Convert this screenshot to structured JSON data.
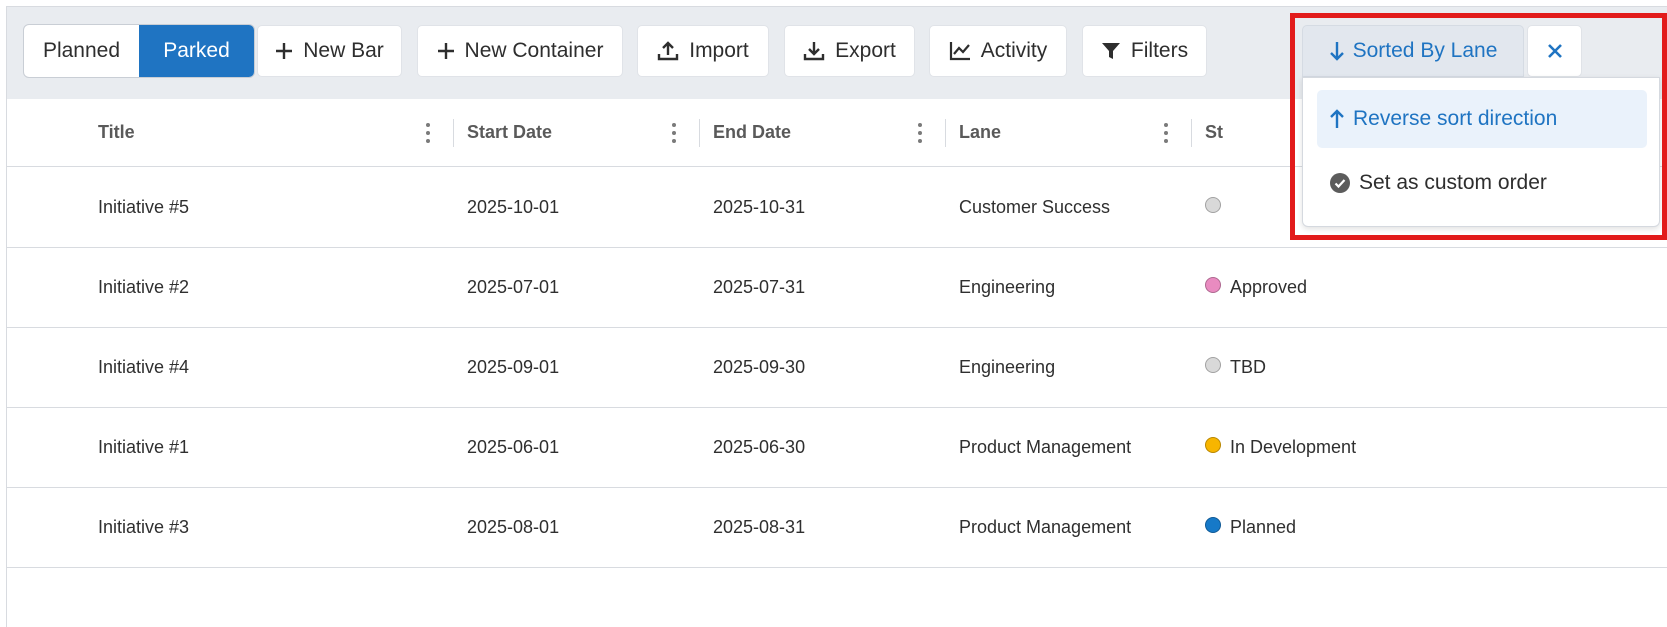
{
  "toolbar": {
    "view_toggle": {
      "planned": "Planned",
      "parked": "Parked"
    },
    "new_bar": "New Bar",
    "new_container": "New Container",
    "import": "Import",
    "export": "Export",
    "activity": "Activity",
    "filters": "Filters",
    "sort": "Sorted By Lane"
  },
  "sort_menu": {
    "reverse": "Reverse sort direction",
    "custom_order": "Set as custom order"
  },
  "table": {
    "columns": [
      "Title",
      "Start Date",
      "End Date",
      "Lane",
      "St"
    ],
    "rows": [
      {
        "title": "Initiative #5",
        "start": "2025-10-01",
        "end": "2025-10-31",
        "lane": "Customer Success",
        "status": "",
        "status_color": "#d9d9d9"
      },
      {
        "title": "Initiative #2",
        "start": "2025-07-01",
        "end": "2025-07-31",
        "lane": "Engineering",
        "status": "Approved",
        "status_color": "#e98bc0"
      },
      {
        "title": "Initiative #4",
        "start": "2025-09-01",
        "end": "2025-09-30",
        "lane": "Engineering",
        "status": "TBD",
        "status_color": "#d9d9d9"
      },
      {
        "title": "Initiative #1",
        "start": "2025-06-01",
        "end": "2025-06-30",
        "lane": "Product Management",
        "status": "In Development",
        "status_color": "#f7b500"
      },
      {
        "title": "Initiative #3",
        "start": "2025-08-01",
        "end": "2025-08-31",
        "lane": "Product Management",
        "status": "Planned",
        "status_color": "#1679c8"
      }
    ]
  },
  "colors": {
    "accent": "#1f74c2",
    "annotation": "#e21b1b"
  }
}
